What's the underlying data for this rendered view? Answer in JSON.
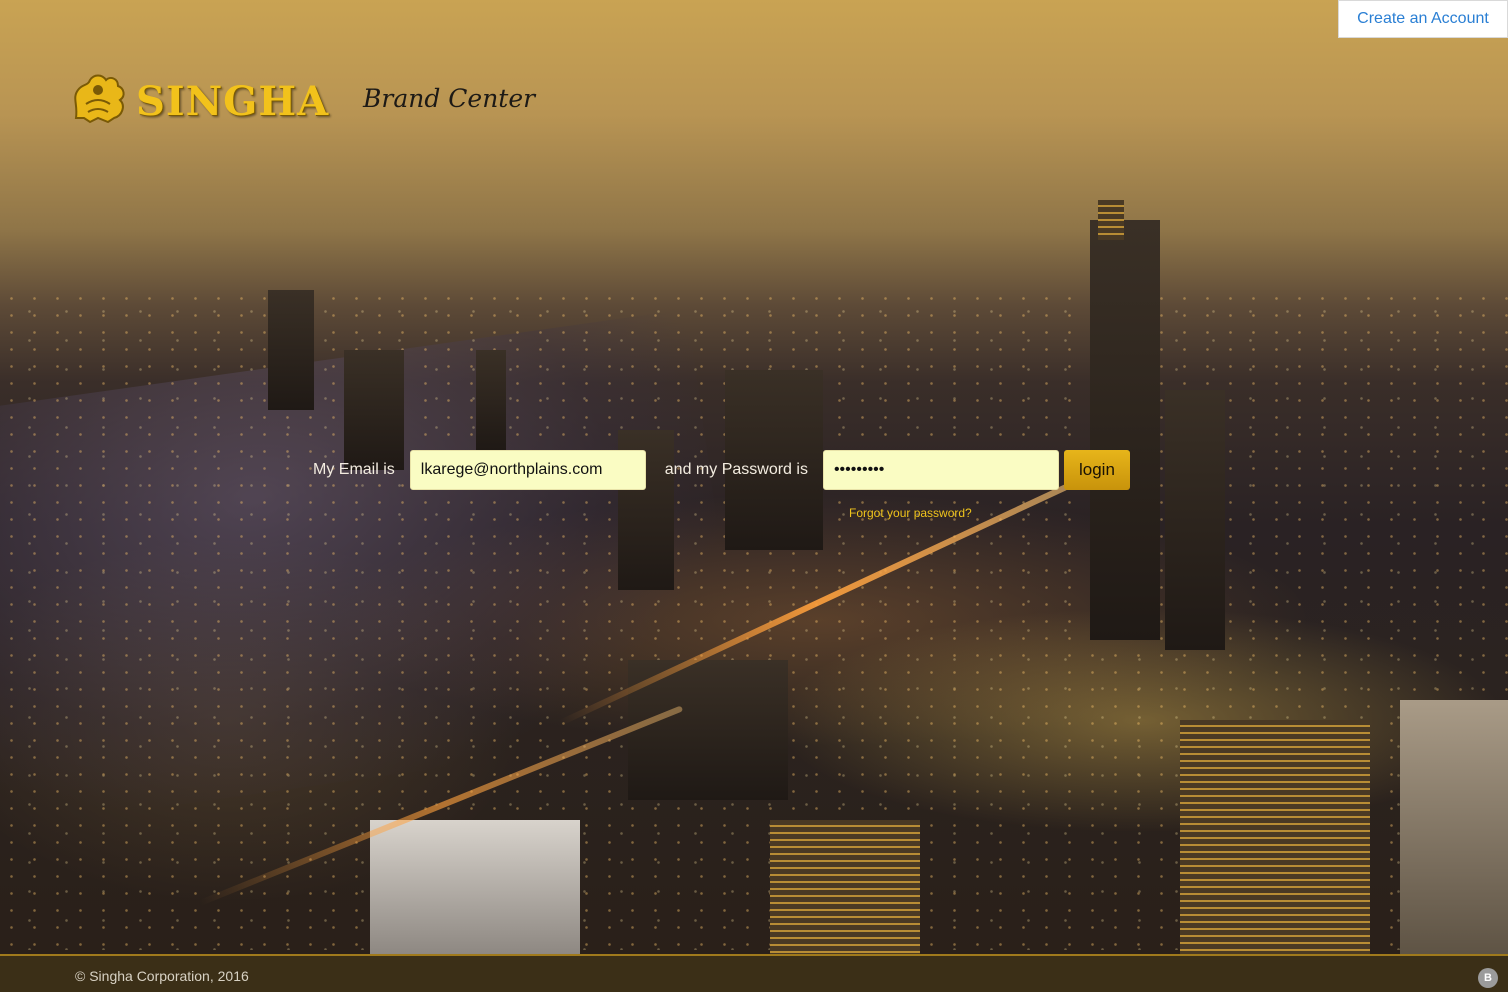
{
  "header": {
    "create_account_label": "Create an Account"
  },
  "brand": {
    "logo_text": "SINGHA",
    "subtitle": "Brand Center",
    "logo_icon": "singha-lion-icon"
  },
  "login": {
    "email_label": "My Email is",
    "email_value": "lkarege@northplains.com",
    "password_label": "and my Password is",
    "password_value": "•••••••••",
    "login_button": "login",
    "forgot_link": "Forgot your password?"
  },
  "footer": {
    "copyright": "© Singha Corporation, 2016",
    "badge": "B"
  },
  "colors": {
    "accent_gold": "#f2c21b",
    "field_bg": "#fafcc3",
    "link_blue": "#2a7fd4",
    "footer_bg": "#3b2f17"
  }
}
